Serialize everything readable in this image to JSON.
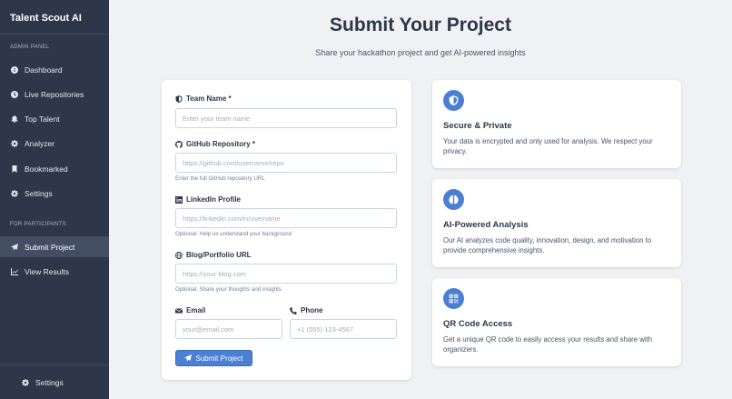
{
  "app": {
    "title": "Talent Scout AI"
  },
  "sidebar": {
    "admin_label": "ADMIN PANEL",
    "admin_items": [
      {
        "label": "Dashboard",
        "icon": "info-circle-icon"
      },
      {
        "label": "Live Repositories",
        "icon": "clock-icon"
      },
      {
        "label": "Top Talent",
        "icon": "bell-icon"
      },
      {
        "label": "Analyzer",
        "icon": "gear-icon"
      },
      {
        "label": "Bookmarked",
        "icon": "bookmark-icon"
      },
      {
        "label": "Settings",
        "icon": "gear-icon"
      }
    ],
    "participants_label": "FOR PARTICIPANTS",
    "participant_items": [
      {
        "label": "Submit Project",
        "icon": "paper-plane-icon",
        "active": true
      },
      {
        "label": "View Results",
        "icon": "chart-icon"
      }
    ],
    "footer": {
      "label": "Settings",
      "icon": "gear-icon"
    }
  },
  "page": {
    "title": "Submit Your Project",
    "subtitle": "Share your hackathon project and get AI-powered insights"
  },
  "form": {
    "team": {
      "label": "Team Name *",
      "placeholder": "Enter your team name",
      "value": ""
    },
    "github": {
      "label": "GitHub Repository *",
      "placeholder": "https://github.com/username/repo",
      "help": "Enter the full GitHub repository URL",
      "value": ""
    },
    "linkedin": {
      "label": "LinkedIn Profile",
      "placeholder": "https://linkedin.com/in/username",
      "help": "Optional: Help us understand your background",
      "value": ""
    },
    "blog": {
      "label": "Blog/Portfolio URL",
      "placeholder": "https://your-blog.com",
      "help": "Optional: Share your thoughts and insights",
      "value": ""
    },
    "email": {
      "label": "Email",
      "placeholder": "your@email.com",
      "value": ""
    },
    "phone": {
      "label": "Phone",
      "placeholder": "+1 (555) 123-4567",
      "value": ""
    },
    "submit_label": "Submit Project"
  },
  "info_cards": [
    {
      "title": "Secure & Private",
      "text": "Your data is encrypted and only used for analysis. We respect your privacy.",
      "icon": "shield-icon"
    },
    {
      "title": "AI-Powered Analysis",
      "text": "Our AI analyzes code quality, innovation, design, and motivation to provide comprehensive insights.",
      "icon": "brain-icon"
    },
    {
      "title": "QR Code Access",
      "text": "Get a unique QR code to easily access your results and share with organizers.",
      "icon": "qrcode-icon"
    }
  ],
  "colors": {
    "sidebar_bg": "#2e3749",
    "accent": "#4a7fd4",
    "page_bg": "#eff1f4"
  }
}
